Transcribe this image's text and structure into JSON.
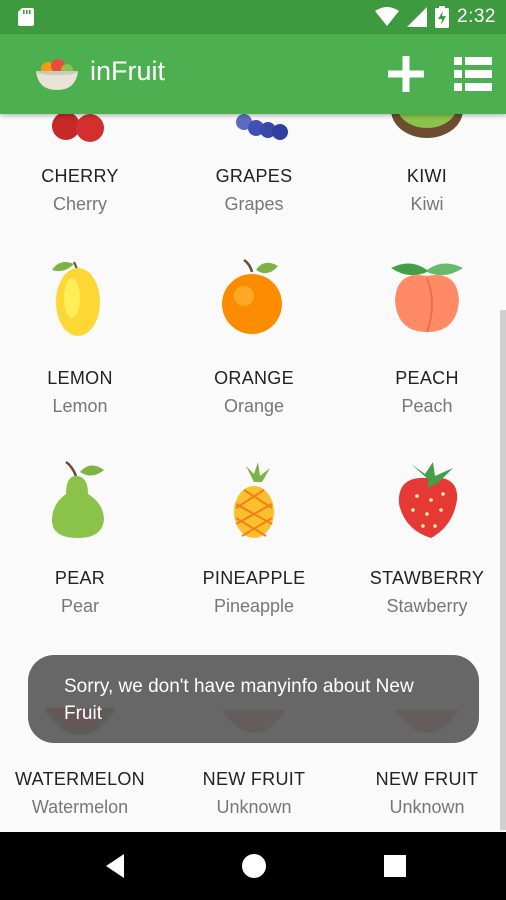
{
  "status_bar": {
    "time": "2:32"
  },
  "app_bar": {
    "title": "inFruit"
  },
  "fruits": [
    {
      "name": "CHERRY",
      "label": "Cherry",
      "icon": "cherry-icon"
    },
    {
      "name": "GRAPES",
      "label": "Grapes",
      "icon": "grapes-icon"
    },
    {
      "name": "KIWI",
      "label": "Kiwi",
      "icon": "kiwi-icon"
    },
    {
      "name": "LEMON",
      "label": "Lemon",
      "icon": "lemon-icon"
    },
    {
      "name": "ORANGE",
      "label": "Orange",
      "icon": "orange-icon"
    },
    {
      "name": "PEACH",
      "label": "Peach",
      "icon": "peach-icon"
    },
    {
      "name": "PEAR",
      "label": "Pear",
      "icon": "pear-icon"
    },
    {
      "name": "PINEAPPLE",
      "label": "Pineapple",
      "icon": "pineapple-icon"
    },
    {
      "name": "STAWBERRY",
      "label": "Stawberry",
      "icon": "strawberry-icon"
    },
    {
      "name": "WATERMELON",
      "label": "Watermelon",
      "icon": "watermelon-icon"
    },
    {
      "name": "NEW FRUIT",
      "label": "Unknown",
      "icon": ""
    },
    {
      "name": "NEW FRUIT",
      "label": "Unknown",
      "icon": ""
    }
  ],
  "toast": {
    "message": "Sorry, we don't have manyinfo about New Fruit"
  },
  "colors": {
    "status_bar": "#3e9a3f",
    "app_bar": "#4caf50",
    "background": "#fafafa",
    "toast": "#5a5a5a",
    "nav_bar": "#000000"
  }
}
